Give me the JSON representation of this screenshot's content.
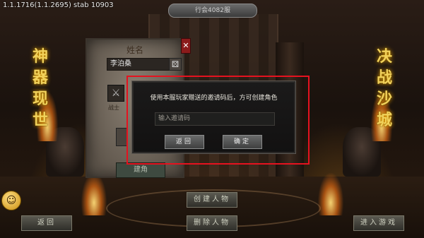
{
  "version_label": "1.1.1716(1.1.2695) stab 10903",
  "top_banner": "行会4082服",
  "left_banner": [
    "神",
    "器",
    "现",
    "世"
  ],
  "right_banner": [
    "决",
    "战",
    "沙",
    "城"
  ],
  "character_panel": {
    "title": "姓名",
    "name_value": "李泊桑",
    "class_label": "战士",
    "create_label": "建角"
  },
  "dialog": {
    "message": "使用本服玩家赠送的邀请码后，方可创建角色",
    "input_placeholder": "输入邀请码",
    "back_label": "返回",
    "confirm_label": "确定"
  },
  "bottom_buttons": {
    "back": "返回",
    "create_character": "创建人物",
    "delete_character": "删除人物",
    "enter_game": "进入游戏"
  },
  "colors": {
    "highlight": "#e5121f",
    "banner_text": "#f1d15a"
  }
}
